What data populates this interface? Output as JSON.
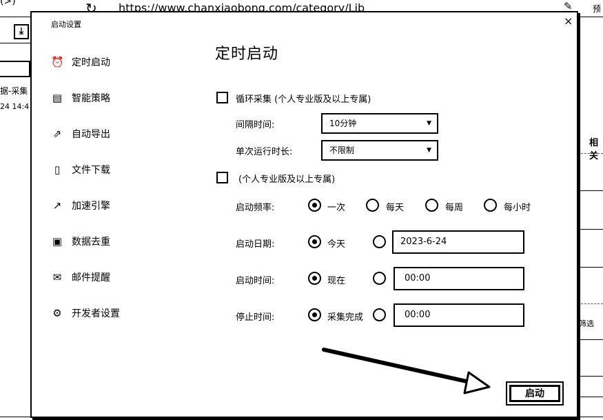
{
  "background": {
    "back_symbol": "(>)",
    "reload_icon": "reload-icon",
    "url": "https://www.chanxiaobong.com/category/Lib",
    "edit_icon": "pen-icon",
    "preview_label": "预",
    "download_icon": "download-icon",
    "left_text_1": "据-采集",
    "left_text_2": "24 14:4",
    "right_title": "相关",
    "right_filter": "筛选"
  },
  "dialog": {
    "title": "启动设置",
    "close_symbol": "×",
    "sidebar": [
      {
        "icon": "alarm-clock-icon",
        "glyph": "⏰",
        "label": "定时启动"
      },
      {
        "icon": "strategy-icon",
        "glyph": "📊",
        "label": "智能策略"
      },
      {
        "icon": "export-icon",
        "glyph": "↗",
        "label": "自动导出"
      },
      {
        "icon": "file-download-icon",
        "glyph": "🗎",
        "label": "文件下载"
      },
      {
        "icon": "speed-engine-icon",
        "glyph": "📈",
        "label": "加速引擎"
      },
      {
        "icon": "deduplicate-icon",
        "glyph": "🗐",
        "label": "数据去重"
      },
      {
        "icon": "mail-icon",
        "glyph": "✉",
        "label": "邮件提醒"
      },
      {
        "icon": "gear-icon",
        "glyph": "⚙",
        "label": "开发者设置"
      }
    ],
    "heading": "定时启动",
    "loop": {
      "checkbox_label": "循环采集 (个人专业版及以上专属)",
      "interval_label": "间隔时间:",
      "interval_value": "10分钟",
      "single_run_label": "单次运行时长:",
      "single_run_value": "不限制"
    },
    "schedule": {
      "checkbox_label": "(个人专业版及以上专属)",
      "frequency_label": "启动频率:",
      "frequency_options": [
        "一次",
        "每天",
        "每周",
        "每小时"
      ],
      "date_label": "启动日期:",
      "date_option": "今天",
      "date_value": "2023-6-24",
      "time_label": "启动时间:",
      "time_option": "现在",
      "time_value": "00:00",
      "stop_label": "停止时间:",
      "stop_option": "采集完成",
      "stop_value": "00:00"
    },
    "start_button": "启动"
  }
}
